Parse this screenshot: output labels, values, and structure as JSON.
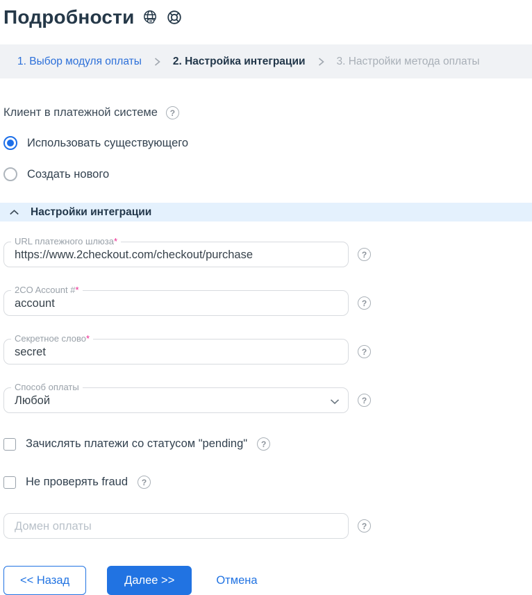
{
  "page": {
    "title": "Подробности"
  },
  "steps": {
    "items": [
      {
        "label": "1. Выбор модуля оплаты",
        "state": "link"
      },
      {
        "label": "2. Настройка интеграции",
        "state": "active"
      },
      {
        "label": "3. Настройки метода оплаты",
        "state": "disabled"
      }
    ]
  },
  "help_icon": {
    "glyph": "?"
  },
  "client_section": {
    "label": "Клиент в платежной системе",
    "options": [
      {
        "label": "Использовать существующего",
        "selected": true
      },
      {
        "label": "Создать нового",
        "selected": false
      }
    ]
  },
  "integration": {
    "title": "Настройки интеграции",
    "fields": [
      {
        "label": "URL платежного шлюза",
        "required_mark": "*",
        "value": "https://www.2checkout.com/checkout/purchase",
        "type": "text"
      },
      {
        "label": "2CO Account #",
        "required_mark": "*",
        "value": "account",
        "type": "text"
      },
      {
        "label": "Секретное слово",
        "required_mark": "*",
        "value": "secret",
        "type": "text"
      },
      {
        "label": "Способ оплаты",
        "required_mark": "",
        "value": "Любой",
        "type": "select"
      }
    ],
    "checkboxes": [
      {
        "label": "Зачислять платежи со статусом \"pending\"",
        "checked": false
      },
      {
        "label": "Не проверять fraud",
        "checked": false
      }
    ],
    "domain_field": {
      "placeholder": "Домен оплаты",
      "value": ""
    }
  },
  "footer": {
    "back_label": "<< Назад",
    "next_label": "Далее >>",
    "cancel_label": "Отмена"
  },
  "colors": {
    "accent_blue": "#2173e2",
    "link_blue": "#2b6fd9",
    "title_navy": "#253848",
    "step_bar_bg": "#f0f2f5",
    "section_bg": "#e4f1fd",
    "required_pink": "#ec268f"
  }
}
